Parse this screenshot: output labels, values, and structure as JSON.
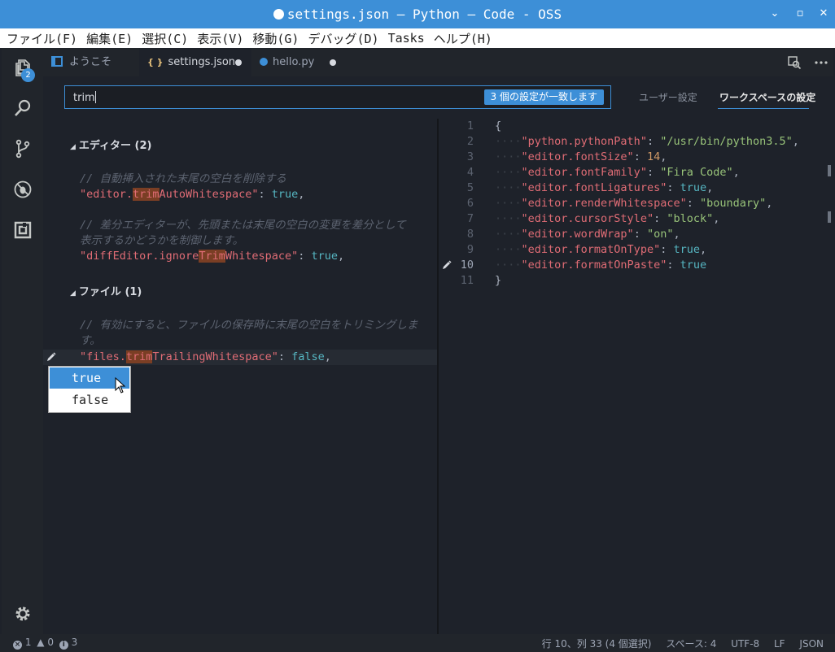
{
  "window": {
    "title": "settings.json — Python — Code - OSS",
    "minimize": "⌄",
    "maximize": "▫",
    "close": "✕"
  },
  "menu": [
    "ファイル(F)",
    "編集(E)",
    "選択(C)",
    "表示(V)",
    "移動(G)",
    "デバッグ(D)",
    "Tasks",
    "ヘルプ(H)"
  ],
  "activity": {
    "explorer_badge": "2",
    "items": [
      "files-icon",
      "search-icon",
      "source-control-icon",
      "debug-icon",
      "extensions-icon",
      "gear-icon"
    ]
  },
  "tabs": [
    {
      "label": "ようこそ",
      "icon": "welcome-icon"
    },
    {
      "label": "settings.json",
      "icon": "json-icon",
      "prefix": "{ }"
    },
    {
      "label": "hello.py",
      "icon": "python-icon"
    }
  ],
  "search": {
    "value": "trim",
    "count_label": "3 個の設定が一致します"
  },
  "scopes": {
    "user": "ユーザー設定",
    "workspace": "ワークスペースの設定"
  },
  "defaults": {
    "group_editor": "エディター (2)",
    "comment1": "// 自動挿入された末尾の空白を削除する",
    "s1_pre": "\"editor.",
    "s1_hl": "trim",
    "s1_post": "AutoWhitespace\"",
    "s1_val": "true",
    "comment2a": "// 差分エディターが、先頭または末尾の空白の変更を差分として",
    "comment2b": "表示するかどうかを制御します。",
    "s2_pre": "\"diffEditor.ignore",
    "s2_hl": "Trim",
    "s2_post": "Whitespace\"",
    "s2_val": "true",
    "group_files": "ファイル (1)",
    "comment3a": "// 有効にすると、ファイルの保存時に末尾の空白をトリミングしま",
    "comment3b": "す。",
    "s3_pre": "\"files.",
    "s3_hl": "trim",
    "s3_post": "TrailingWhitespace\"",
    "s3_val": "false"
  },
  "dropdown": {
    "options": [
      "true",
      "false"
    ],
    "selected": "true"
  },
  "workspace_file": {
    "line_numbers": [
      "1",
      "2",
      "3",
      "4",
      "5",
      "6",
      "7",
      "8",
      "9",
      "10",
      "11"
    ],
    "open_brace": "{",
    "close_brace": "}",
    "entries": [
      {
        "key": "\"python.pythonPath\"",
        "value": "\"/usr/bin/python3.5\"",
        "type": "str",
        "comma": ","
      },
      {
        "key": "\"editor.fontSize\"",
        "value": "14",
        "type": "num",
        "comma": ","
      },
      {
        "key": "\"editor.fontFamily\"",
        "value": "\"Fira Code\"",
        "type": "str",
        "comma": ","
      },
      {
        "key": "\"editor.fontLigatures\"",
        "value": "true",
        "type": "kw",
        "comma": ","
      },
      {
        "key": "\"editor.renderWhitespace\"",
        "value": "\"boundary\"",
        "type": "str",
        "comma": ","
      },
      {
        "key": "\"editor.cursorStyle\"",
        "value": "\"block\"",
        "type": "str",
        "comma": ","
      },
      {
        "key": "\"editor.wordWrap\"",
        "value": "\"on\"",
        "type": "str",
        "comma": ","
      },
      {
        "key": "\"editor.formatOnType\"",
        "value": "true",
        "type": "kw",
        "comma": ","
      },
      {
        "key": "\"editor.formatOnPaste\"",
        "value": "true",
        "type": "kw",
        "comma": ""
      }
    ]
  },
  "status": {
    "errors": "1",
    "warnings": "0",
    "infos": "3",
    "position": "行 10、列 33 (4 個選択)",
    "spaces": "スペース: 4",
    "encoding": "UTF-8",
    "eol": "LF",
    "language": "JSON"
  },
  "colors": {
    "accent": "#3d8fd7",
    "match_highlight": "#7a3e24"
  }
}
